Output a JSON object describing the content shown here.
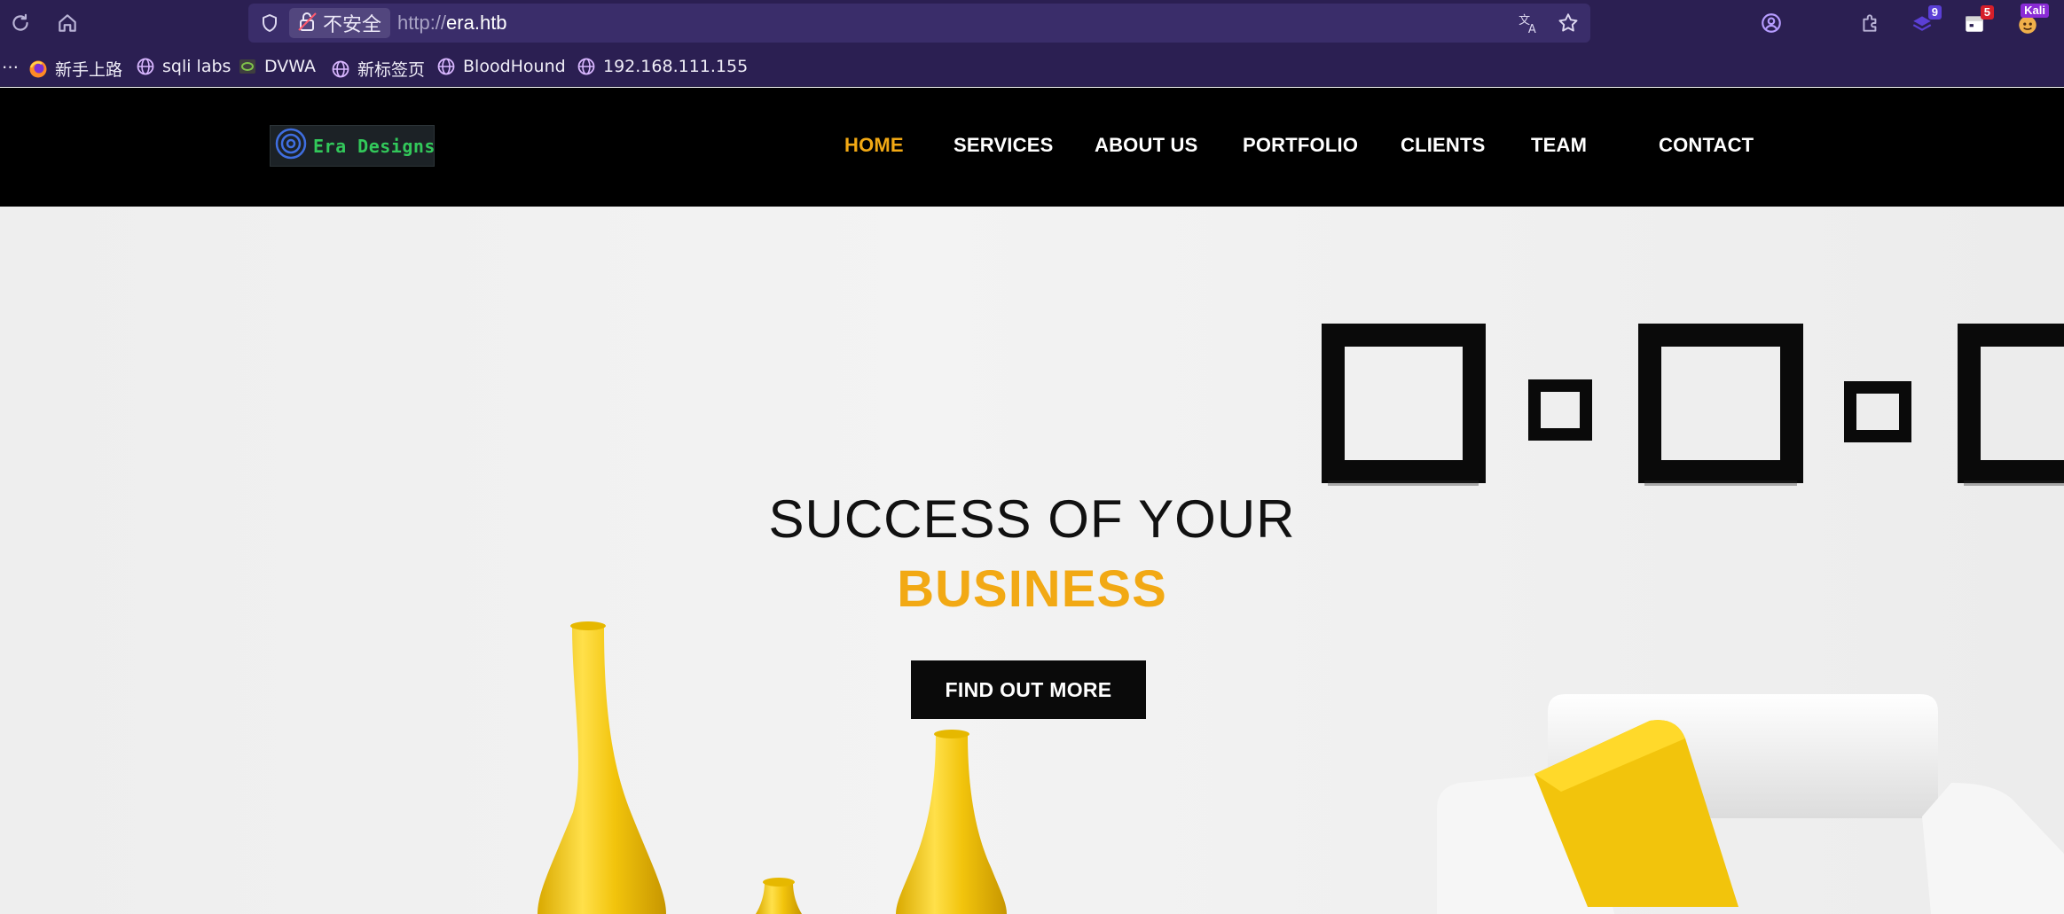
{
  "browser": {
    "security_label": "不安全",
    "url_protocol": "http://",
    "url_host": "era.htb",
    "extensions": [
      {
        "icon": "extension-badge-icon",
        "badge": "9",
        "badge_color": "#5b3fd6"
      },
      {
        "icon": "extension-calendar-icon",
        "badge": "5",
        "badge_color": "#d61f2a"
      },
      {
        "icon": "kali-avatar-icon",
        "badge": "Kali",
        "badge_color": "#8a2bd6"
      }
    ],
    "bookmarks": [
      {
        "label": "新手上路",
        "icon": "firefox-icon"
      },
      {
        "label": "sqli labs",
        "icon": "globe-icon"
      },
      {
        "label": "DVWA",
        "icon": "dvwa-icon"
      },
      {
        "label": "新标签页",
        "icon": "globe-icon"
      },
      {
        "label": "BloodHound",
        "icon": "globe-icon"
      },
      {
        "label": "192.168.111.155",
        "icon": "globe-icon"
      }
    ],
    "bookmarks_overflow": "…"
  },
  "site": {
    "logo_text": "Era Designs",
    "nav": [
      {
        "label": "HOME",
        "active": true
      },
      {
        "label": "SERVICES",
        "active": false
      },
      {
        "label": "ABOUT US",
        "active": false
      },
      {
        "label": "PORTFOLIO",
        "active": false
      },
      {
        "label": "CLIENTS",
        "active": false
      },
      {
        "label": "TEAM",
        "active": false
      },
      {
        "label": "CONTACT",
        "active": false
      }
    ],
    "hero": {
      "title": "SUCCESS OF YOUR",
      "accent": "BUSINESS",
      "cta_label": "FIND OUT MORE"
    }
  },
  "colors": {
    "browser_bg": "#2b1f52",
    "urlbar_bg": "#3a2d6a",
    "accent": "#f2a914",
    "nav_bg": "#000000",
    "logo_green": "#32c85a"
  }
}
